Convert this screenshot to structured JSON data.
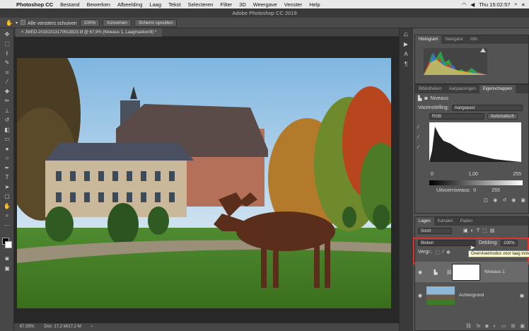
{
  "menubar": {
    "app": "Photoshop CC",
    "items": [
      "Bestand",
      "Bewerken",
      "Afbeelding",
      "Laag",
      "Tekst",
      "Selecteren",
      "Filter",
      "3D",
      "Weergave",
      "Venster",
      "Help"
    ],
    "clock": "Thu 15:02:57"
  },
  "window": {
    "title": "Adobe Photoshop CC 2019"
  },
  "options": {
    "scroll_all": "Alle vensters schuiven",
    "zoom": "100%",
    "fit": "Inzoomen",
    "fill": "Scherm opvullen"
  },
  "document": {
    "tab": "JWED-20181013170913823.tif @ 67,9% (Niveaus 1, Laagmasker/8) *",
    "zoom": "67,93%",
    "doc_size": "Doc: 17,2 M/17,2 M"
  },
  "histogram": {
    "tabs": [
      "Histogram",
      "Navigator",
      "Info"
    ]
  },
  "properties": {
    "tabs": [
      "Bibliotheken",
      "Aanpassingen",
      "Eigenschappen"
    ],
    "title": "Niveaus",
    "preset_label": "Voorinstelling:",
    "preset_value": "Aangepast",
    "channel": "RGB",
    "auto": "Automatisch",
    "input_black": "0",
    "input_gamma": "1,00",
    "input_white": "255",
    "output_label": "Uitvoerniveaus:",
    "output_black": "0",
    "output_white": "255"
  },
  "layers": {
    "tabs": [
      "Lagen",
      "Kanalen",
      "Paden"
    ],
    "filter": "Soort",
    "blend": "Bleken",
    "opacity_label": "Dekking:",
    "opacity": "100%",
    "lock_label": "Vergr.:",
    "tooltip": "Overvloeimodus voor laag instellen",
    "layer1": "Niveaus 1",
    "layer2": "Achtergrond"
  }
}
